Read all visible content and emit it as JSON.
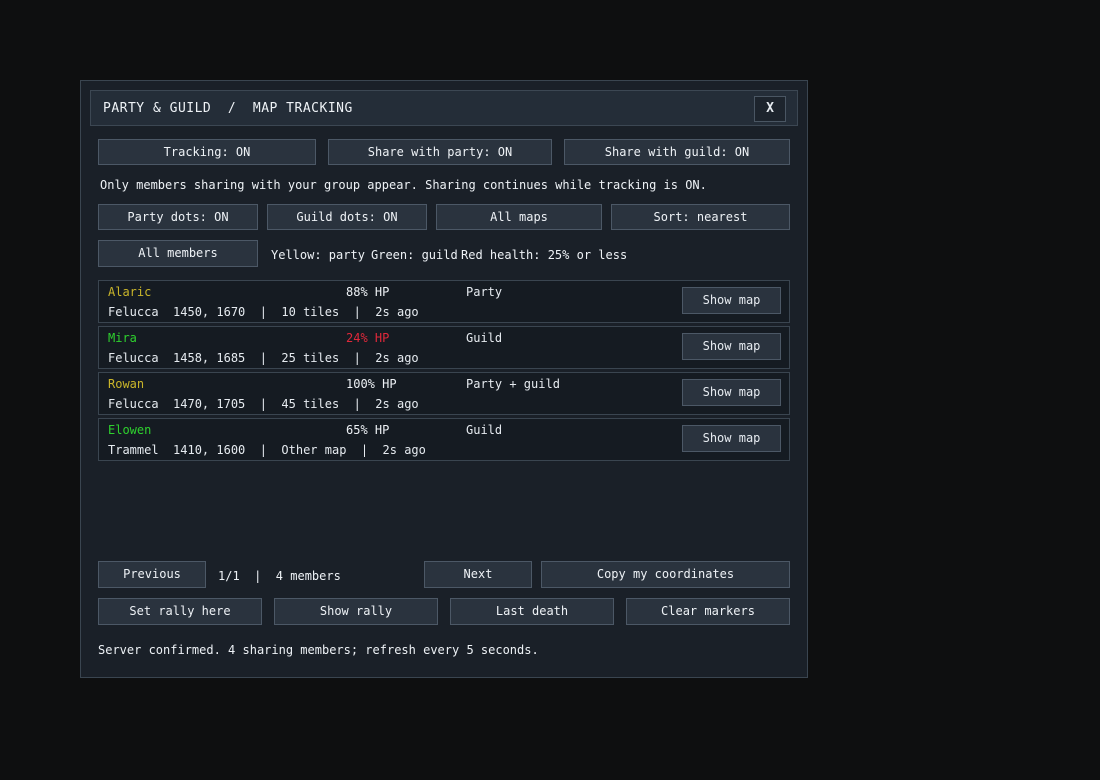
{
  "window": {
    "title": "PARTY & GUILD  /  MAP TRACKING",
    "close_label": "X"
  },
  "toggles_row1": {
    "tracking": "Tracking: ON",
    "share_party": "Share with party: ON",
    "share_guild": "Share with guild: ON"
  },
  "info_text": "Only members sharing with your group appear. Sharing continues while tracking is ON.",
  "toggles_row2": {
    "party_dots": "Party dots: ON",
    "guild_dots": "Guild dots: ON",
    "all_maps": "All maps",
    "sort": "Sort: nearest"
  },
  "filter": {
    "all_members": "All members",
    "legend_party": "Yellow: party",
    "legend_guild": "Green: guild",
    "legend_health": "Red health: 25% or less"
  },
  "colors": {
    "party": "#c9b52a",
    "guild": "#2ed12e",
    "low_health": "#e0283a",
    "text": "#eef2f6"
  },
  "members": [
    {
      "name": "Alaric",
      "location": "Felucca  1450, 1670  |  10 tiles  |  2s ago",
      "hp": "88% HP",
      "group": "Party",
      "show_map": "Show map",
      "name_color": "#c9b52a",
      "hp_color": "#eef2f6"
    },
    {
      "name": "Mira",
      "location": "Felucca  1458, 1685  |  25 tiles  |  2s ago",
      "hp": "24% HP",
      "group": "Guild",
      "show_map": "Show map",
      "name_color": "#2ed12e",
      "hp_color": "#e0283a"
    },
    {
      "name": "Rowan",
      "location": "Felucca  1470, 1705  |  45 tiles  |  2s ago",
      "hp": "100% HP",
      "group": "Party + guild",
      "show_map": "Show map",
      "name_color": "#c9b52a",
      "hp_color": "#eef2f6"
    },
    {
      "name": "Elowen",
      "location": "Trammel  1410, 1600  |  Other map  |  2s ago",
      "hp": "65% HP",
      "group": "Guild",
      "show_map": "Show map",
      "name_color": "#2ed12e",
      "hp_color": "#eef2f6"
    }
  ],
  "pagination": {
    "previous": "Previous",
    "status": "1/1  |  4 members",
    "next": "Next",
    "copy_coords": "Copy my coordinates"
  },
  "actions": {
    "set_rally": "Set rally here",
    "show_rally": "Show rally",
    "last_death": "Last death",
    "clear_markers": "Clear markers"
  },
  "status_text": "Server confirmed. 4 sharing members; refresh every 5 seconds."
}
